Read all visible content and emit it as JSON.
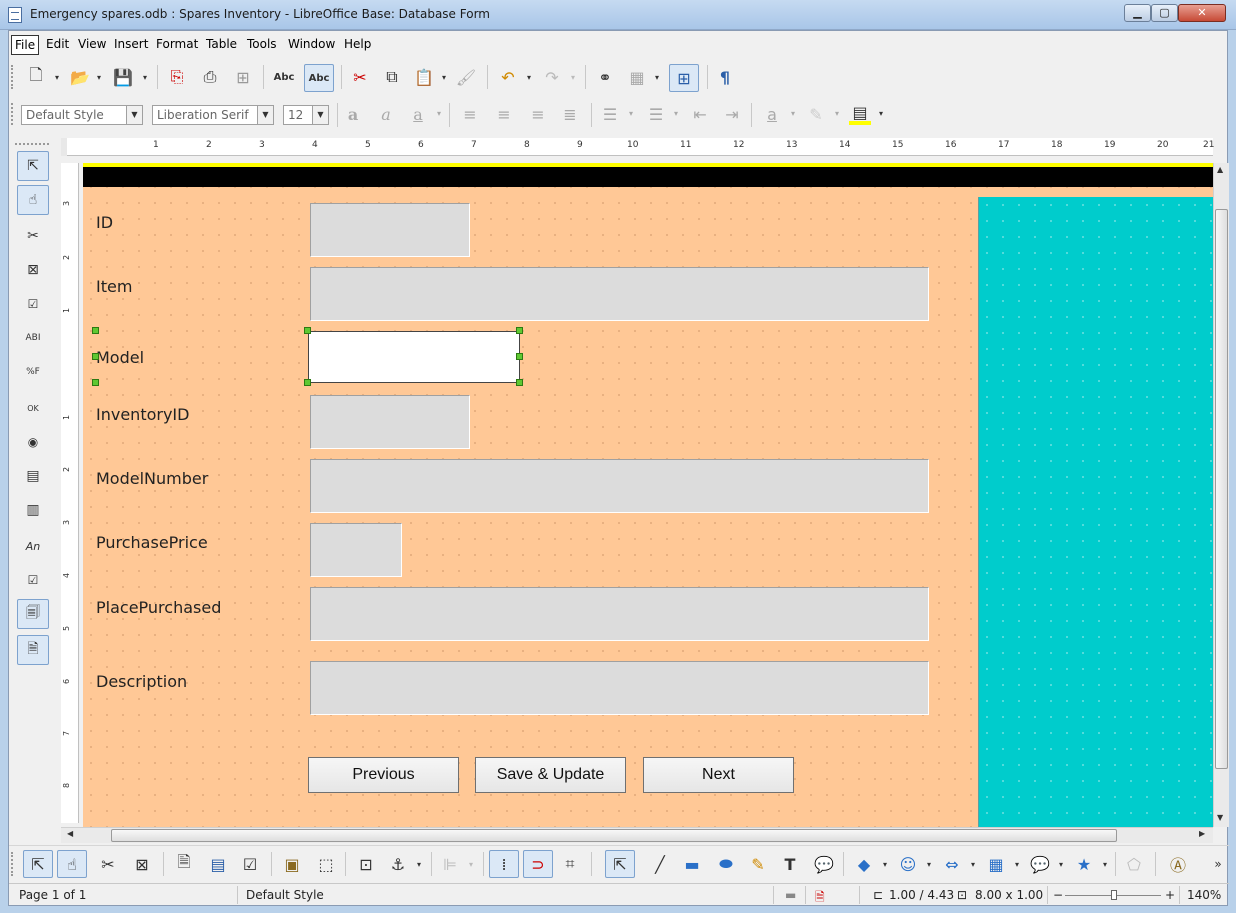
{
  "window": {
    "title": "Emergency spares.odb : Spares Inventory - LibreOffice Base: Database Form",
    "minimize": "▁",
    "maximize": "▢",
    "close": "✕"
  },
  "menu": [
    "File",
    "Edit",
    "View",
    "Insert",
    "Format",
    "Table",
    "Tools",
    "Window",
    "Help"
  ],
  "format_toolbar": {
    "paragraph_style": "Default Style",
    "font_name": "Liberation Serif",
    "font_size": "12"
  },
  "ruler": {
    "h_numbers": [
      "1",
      "2",
      "3",
      "4",
      "5",
      "6",
      "7",
      "8",
      "9",
      "10",
      "11",
      "12",
      "13",
      "14",
      "15",
      "16",
      "17",
      "18",
      "19",
      "20",
      "21"
    ],
    "v_numbers": [
      "3",
      "2",
      "1",
      "1",
      "2",
      "3",
      "4",
      "5",
      "6",
      "7",
      "8",
      "9"
    ]
  },
  "form": {
    "fields": [
      {
        "label": "ID"
      },
      {
        "label": "Item"
      },
      {
        "label": "Model"
      },
      {
        "label": "InventoryID"
      },
      {
        "label": "ModelNumber"
      },
      {
        "label": "PurchasePrice"
      },
      {
        "label": "PlacePurchased"
      },
      {
        "label": "Description"
      }
    ],
    "buttons": {
      "previous": "Previous",
      "save_update": "Save & Update",
      "next": "Next"
    }
  },
  "statusbar": {
    "page": "Page 1 of 1",
    "style": "Default Style",
    "position": "1.00 / 4.43",
    "size": "8.00 x 1.00",
    "zoom": "140%",
    "zoom_minus": "−",
    "zoom_plus": "+"
  },
  "colors": {
    "form_background": "#ffc896",
    "side_panel": "#00cccc",
    "header_bar": "#000000",
    "header_line": "#ffff00"
  }
}
